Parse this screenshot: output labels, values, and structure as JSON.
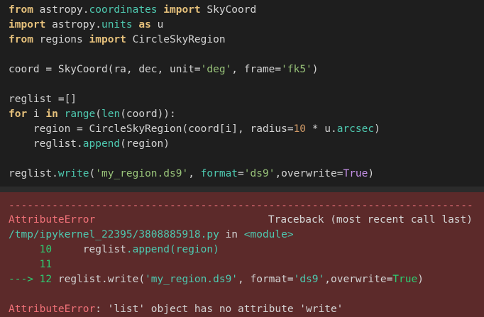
{
  "code": {
    "l1": {
      "kw1": "from",
      "mod1": "astropy.",
      "mod2": "coordinates",
      "kw2": "import",
      "rest": "SkyCoord"
    },
    "l2": {
      "kw1": "import",
      "mod1": "astropy.",
      "mod2": "units",
      "kw2": "as",
      "rest": "u"
    },
    "l3": {
      "kw1": "from",
      "mod1": "regions",
      "kw2": "import",
      "rest": "CircleSkyRegion"
    },
    "l4": {
      "a": "coord = SkyCoord(ra, dec, unit=",
      "s1": "'deg'",
      "b": ", frame=",
      "s2": "'fk5'",
      "c": ")"
    },
    "l5": {
      "a": "reglist =[]"
    },
    "l6": {
      "kw1": "for",
      "a": " i ",
      "kw2": "in",
      "b": " ",
      "bi1": "range",
      "c": "(",
      "bi2": "len",
      "d": "(coord)):"
    },
    "l7": {
      "a": "    region = CircleSkyRegion(coord[i], radius=",
      "n": "10",
      "b": " * u.",
      "m": "arcsec",
      "c": ")"
    },
    "l8": {
      "a": "    reglist.",
      "m": "append",
      "b": "(region)"
    },
    "l9": {
      "a": "reglist.",
      "m": "write",
      "b": "(",
      "s1": "'my_region.ds9'",
      "c": ", ",
      "k": "format",
      "d": "=",
      "s2": "'ds9'",
      "e": ",overwrite=",
      "t": "True",
      "f": ")"
    }
  },
  "output": {
    "dashes": "---------------------------------------------------------------------------",
    "err_name": "AttributeError",
    "traceback": "Traceback (most recent call last)",
    "path": "/tmp/ipykernel_22395/3808885918.py",
    "in": "in",
    "module": "<module>",
    "line10_no": "10",
    "line10_code_a": "reglist",
    "line10_code_b": ".append(region)",
    "line11_no": "11",
    "arrow": "--->",
    "line12_no": "12",
    "line12_a": "reglist.write(",
    "line12_s1": "'my_region.ds9'",
    "line12_b": ", format=",
    "line12_s2": "'ds9'",
    "line12_c": ",overwrite=",
    "line12_t": "True",
    "line12_d": ")",
    "final_name": "AttributeError",
    "final_msg": ": 'list' object has no attribute 'write'"
  }
}
